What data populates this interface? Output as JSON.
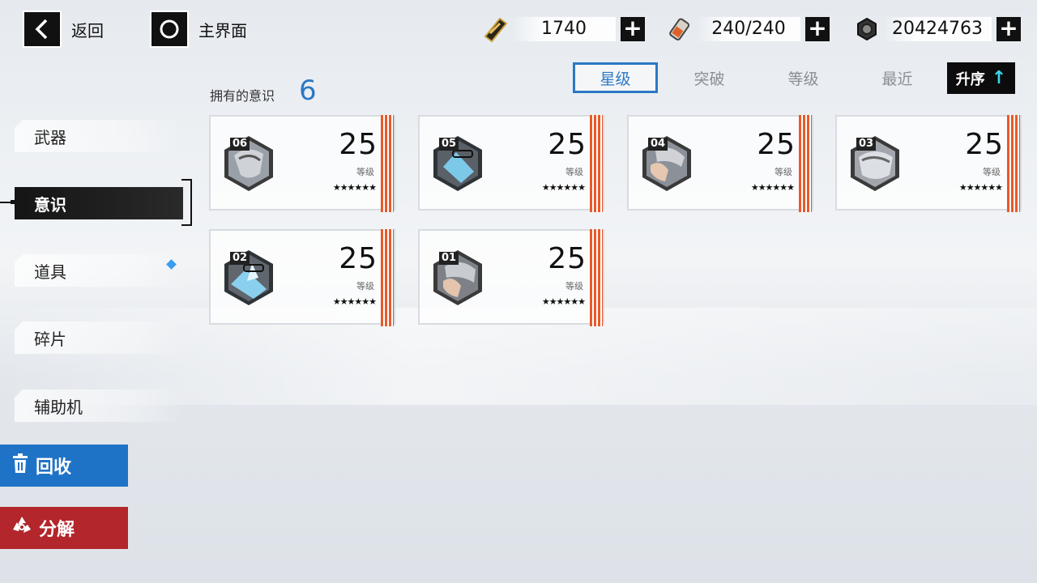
{
  "nav": {
    "back_label": "返回",
    "home_label": "主界面"
  },
  "currencies": [
    {
      "icon": "ticket-icon",
      "value": "1740"
    },
    {
      "icon": "stamina-icon",
      "value": "240/240"
    },
    {
      "icon": "gear-coin-icon",
      "value": "20424763"
    }
  ],
  "sort": {
    "tabs": [
      "星级",
      "突破",
      "等级",
      "最近"
    ],
    "active_index": 0,
    "order_label": "升序",
    "order_arrow": "↑"
  },
  "owned": {
    "label": "拥有的意识",
    "count": "6"
  },
  "sidebar": {
    "items": [
      {
        "label": "武器"
      },
      {
        "label": "意识",
        "active": true
      },
      {
        "label": "道具",
        "badge": true
      },
      {
        "label": "碎片"
      },
      {
        "label": "辅助机"
      }
    ]
  },
  "actions": {
    "recycle_label": "回收",
    "dismantle_label": "分解"
  },
  "cards": [
    {
      "index": "06",
      "level": "25",
      "level_label": "等级",
      "stars": "★★★★★★"
    },
    {
      "index": "05",
      "level": "25",
      "level_label": "等级",
      "stars": "★★★★★★"
    },
    {
      "index": "04",
      "level": "25",
      "level_label": "等级",
      "stars": "★★★★★★"
    },
    {
      "index": "03",
      "level": "25",
      "level_label": "等级",
      "stars": "★★★★★★"
    },
    {
      "index": "02",
      "level": "25",
      "level_label": "等级",
      "stars": "★★★★★★"
    },
    {
      "index": "01",
      "level": "25",
      "level_label": "等级",
      "stars": "★★★★★★"
    }
  ],
  "colors": {
    "accent_blue": "#2b78c4",
    "recycle_blue": "#1f73c6",
    "dismantle_red": "#b3262c",
    "stripe_orange": "#e85a2a",
    "sort_arrow": "#3bd6e6"
  }
}
